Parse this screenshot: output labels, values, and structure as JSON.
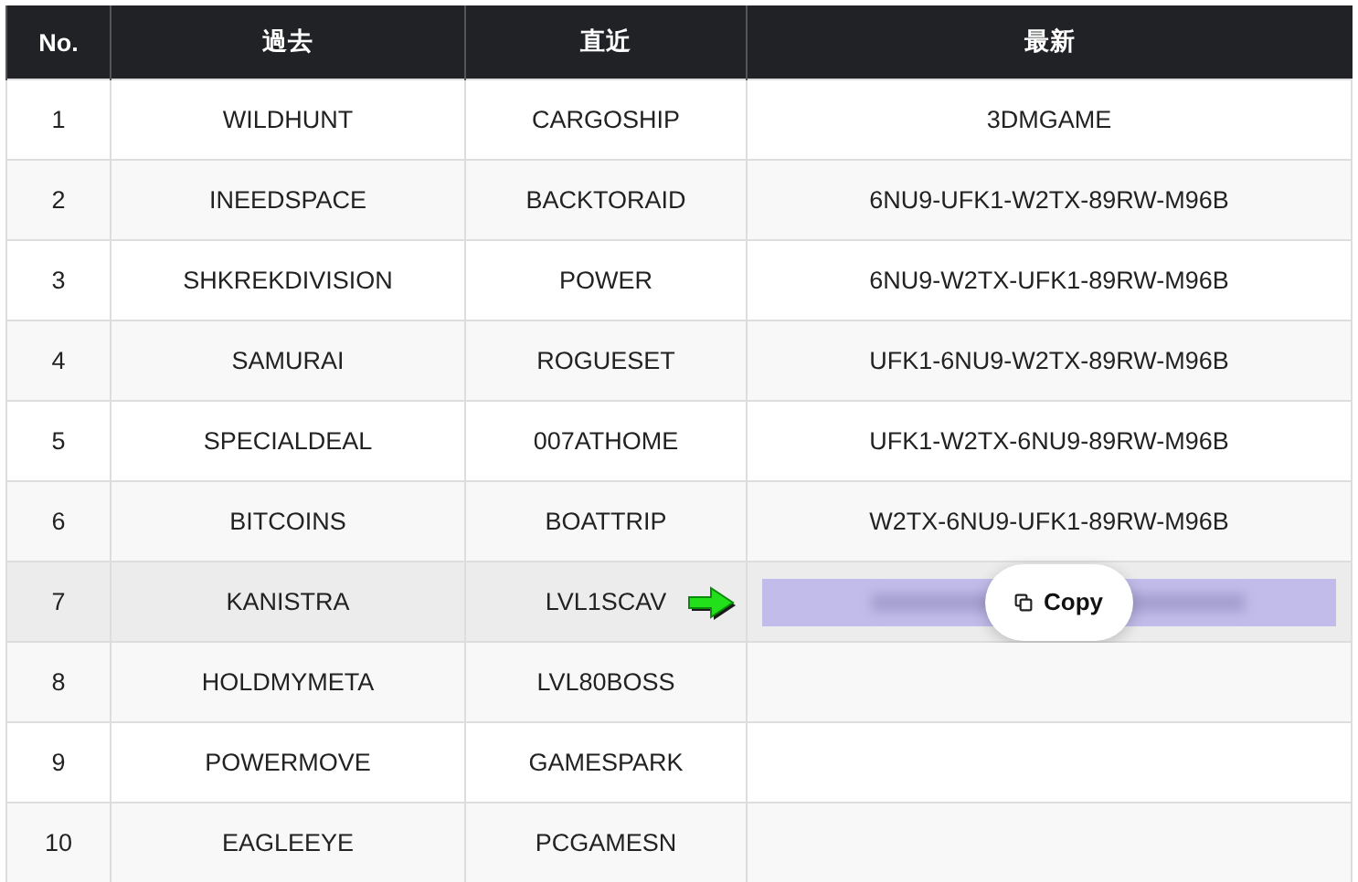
{
  "columns": [
    "No.",
    "過去",
    "直近",
    "最新"
  ],
  "rows": [
    {
      "no": "1",
      "past": "WILDHUNT",
      "recent": "CARGOSHIP",
      "latest": {
        "kind": "text",
        "text": "3DMGAME"
      },
      "highlighted": false
    },
    {
      "no": "2",
      "past": "INEEDSPACE",
      "recent": "BACKTORAID",
      "latest": {
        "kind": "text",
        "text": "6NU9-UFK1-W2TX-89RW-M96B"
      },
      "highlighted": false
    },
    {
      "no": "3",
      "past": "SHKREKDIVISION",
      "recent": "POWER",
      "latest": {
        "kind": "text",
        "text": "6NU9-W2TX-UFK1-89RW-M96B"
      },
      "highlighted": false
    },
    {
      "no": "4",
      "past": "SAMURAI",
      "recent": "ROGUESET",
      "latest": {
        "kind": "text",
        "text": "UFK1-6NU9-W2TX-89RW-M96B"
      },
      "highlighted": false
    },
    {
      "no": "5",
      "past": "SPECIALDEAL",
      "recent": "007ATHOME",
      "latest": {
        "kind": "text",
        "text": "UFK1-W2TX-6NU9-89RW-M96B"
      },
      "highlighted": false
    },
    {
      "no": "6",
      "past": "BITCOINS",
      "recent": "BOATTRIP",
      "latest": {
        "kind": "text",
        "text": "W2TX-6NU9-UFK1-89RW-M96B"
      },
      "highlighted": false
    },
    {
      "no": "7",
      "past": "KANISTRA",
      "recent": "LVL1SCAV",
      "latest": {
        "kind": "blurred",
        "copy_button": "Copy"
      },
      "highlighted": true
    },
    {
      "no": "8",
      "past": "HOLDMYMETA",
      "recent": "LVL80BOSS",
      "highlighted": false
    },
    {
      "no": "9",
      "past": "POWERMOVE",
      "recent": "GAMESPARK",
      "highlighted": false
    },
    {
      "no": "10",
      "past": "EAGLEEYE",
      "recent": "PCGAMESN",
      "highlighted": false
    }
  ]
}
